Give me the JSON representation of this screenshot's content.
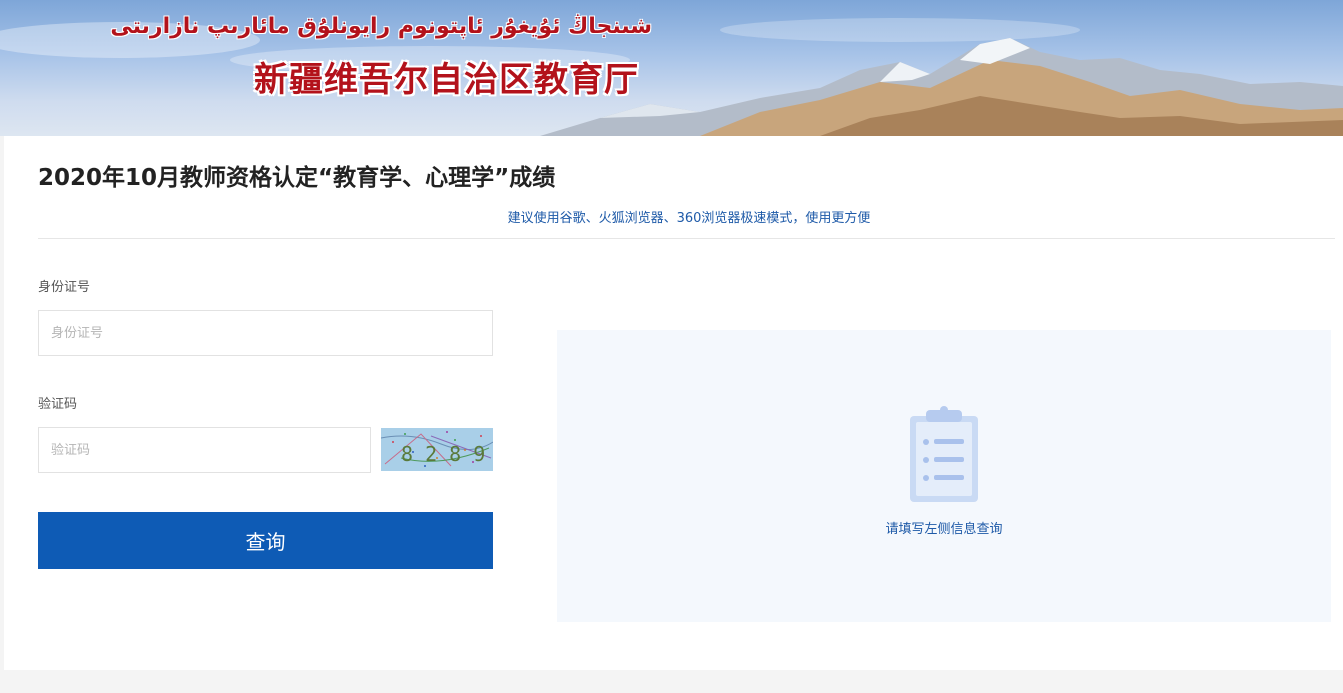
{
  "banner": {
    "uyghur_title": "شىنجاڭ ئۇيغۇر ئاپتونوم رايونلۇق مائارىپ نازارىتى",
    "chinese_title": "新疆维吾尔自治区教育厅"
  },
  "page": {
    "title": "2020年10月教师资格认定“教育学、心理学”成绩",
    "browser_tip": "建议使用谷歌、火狐浏览器、360浏览器极速模式，使用更方便"
  },
  "form": {
    "id_label": "身份证号",
    "id_placeholder": "身份证号",
    "id_value": "",
    "captcha_label": "验证码",
    "captcha_placeholder": "验证码",
    "captcha_value": "",
    "captcha_code": "8 2 8 9",
    "submit_label": "查询"
  },
  "result": {
    "hint": "请填写左侧信息查询",
    "icon": "clipboard-icon"
  },
  "colors": {
    "primary": "#0e5bb5",
    "link_text": "#1e5aa8",
    "banner_title": "#b3121b",
    "result_bg": "#f4f8fd"
  }
}
